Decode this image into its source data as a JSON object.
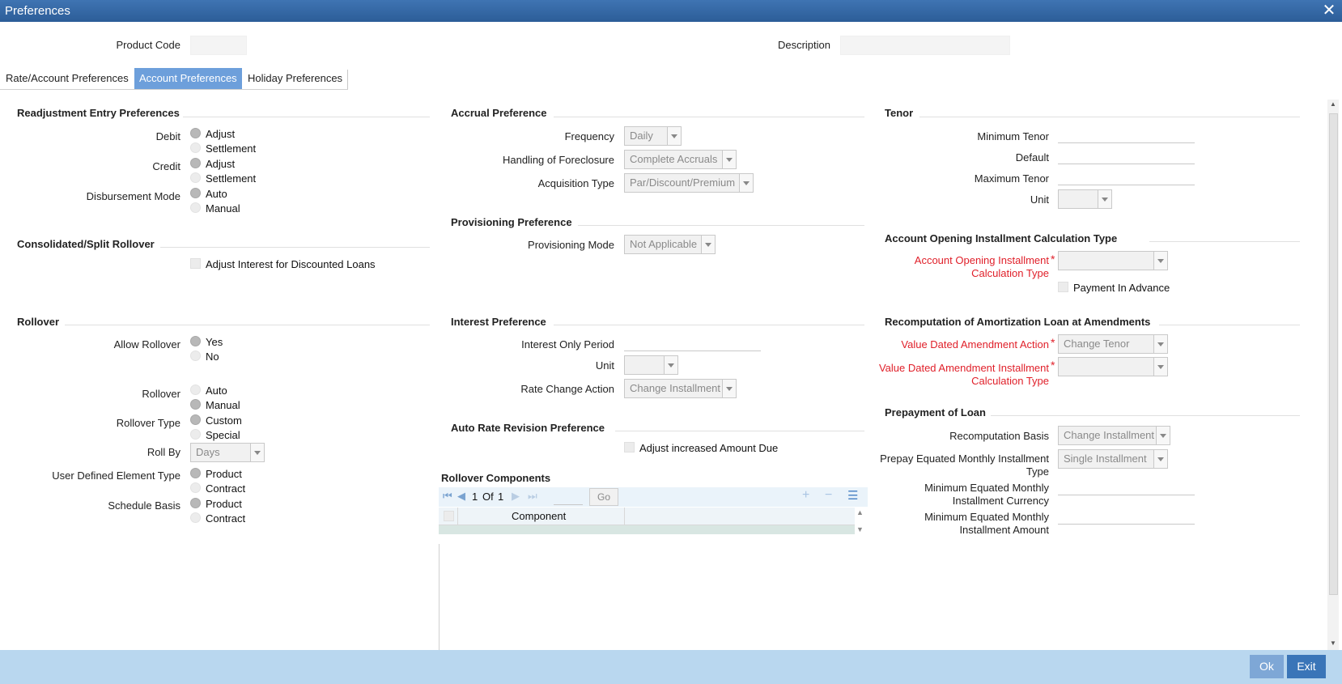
{
  "window": {
    "title": "Preferences",
    "close_glyph": "✕"
  },
  "header": {
    "product_code_label": "Product Code",
    "description_label": "Description"
  },
  "tabs": [
    {
      "label": "Rate/Account Preferences"
    },
    {
      "label": "Account Preferences"
    },
    {
      "label": "Holiday Preferences"
    }
  ],
  "readjust": {
    "title": "Readjustment Entry Preferences",
    "debit_label": "Debit",
    "credit_label": "Credit",
    "disb_label": "Disbursement Mode",
    "adjust": "Adjust",
    "settlement": "Settlement",
    "auto": "Auto",
    "manual": "Manual"
  },
  "consolidated": {
    "title": "Consolidated/Split Rollover",
    "adjust_interest": "Adjust Interest for Discounted Loans"
  },
  "rollover": {
    "title": "Rollover",
    "allow_label": "Allow Rollover",
    "yes": "Yes",
    "no": "No",
    "rollover_label": "Rollover",
    "auto": "Auto",
    "manual": "Manual",
    "type_label": "Rollover Type",
    "custom": "Custom",
    "special": "Special",
    "roll_by_label": "Roll By",
    "roll_by_value": "Days",
    "ude_label": "User Defined Element Type",
    "product": "Product",
    "contract": "Contract",
    "schedule_label": "Schedule Basis"
  },
  "accrual": {
    "title": "Accrual Preference",
    "frequency_label": "Frequency",
    "frequency_value": "Daily",
    "foreclosure_label": "Handling of Foreclosure",
    "foreclosure_value": "Complete Accruals",
    "acquisition_label": "Acquisition Type",
    "acquisition_value": "Par/Discount/Premium"
  },
  "provisioning": {
    "title": "Provisioning Preference",
    "mode_label": "Provisioning Mode",
    "mode_value": "Not Applicable"
  },
  "interest": {
    "title": "Interest Preference",
    "only_period_label": "Interest Only Period",
    "unit_label": "Unit",
    "rate_change_label": "Rate Change Action",
    "rate_change_value": "Change Installment"
  },
  "auto_rate": {
    "title": "Auto Rate Revision Preference",
    "adjust_label": "Adjust increased Amount Due"
  },
  "rollover_components": {
    "title": "Rollover Components",
    "page_current": "1",
    "page_of": "Of",
    "page_total": "1",
    "go_label": "Go",
    "column_component": "Component"
  },
  "tenor": {
    "title": "Tenor",
    "min_label": "Minimum Tenor",
    "default_label": "Default",
    "max_label": "Maximum Tenor",
    "unit_label": "Unit"
  },
  "acct_open": {
    "title": "Account Opening Installment Calculation Type",
    "calc_label_1": "Account Opening Installment",
    "calc_label_2": "Calculation Type",
    "payment_advance": "Payment In Advance"
  },
  "recompute": {
    "title": "Recomputation of Amortization Loan at Amendments",
    "action_label": "Value Dated Amendment Action",
    "action_value": "Change Tenor",
    "inst_label_1": "Value Dated Amendment Installment",
    "inst_label_2": "Calculation Type"
  },
  "prepay": {
    "title": "Prepayment of Loan",
    "basis_label": "Recomputation Basis",
    "basis_value": "Change Installment",
    "emi_type_label_1": "Prepay Equated Monthly Installment",
    "emi_type_label_2": "Type",
    "emi_type_value": "Single Installment",
    "min_cur_label_1": "Minimum Equated Monthly",
    "min_cur_label_2": "Installment Currency",
    "min_amt_label_1": "Minimum Equated Monthly",
    "min_amt_label_2": "Installment Amount"
  },
  "footer": {
    "ok_label": "Ok",
    "exit_label": "Exit"
  },
  "colors": {
    "title_bar": "#2f64a3",
    "active_tab": "#6d9fdb",
    "footer": "#b9d7ef",
    "button": "#3a75b8",
    "required": "#e0202a"
  },
  "icons": [
    "close-icon",
    "first-page-icon",
    "prev-page-icon",
    "next-page-icon",
    "last-page-icon",
    "add-row-icon",
    "delete-row-icon",
    "single-view-icon",
    "dropdown-arrow-icon"
  ]
}
